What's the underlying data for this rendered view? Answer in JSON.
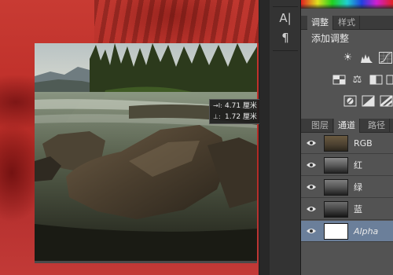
{
  "measurement": {
    "width_label": "4.71 厘米",
    "height_label": "1.72 厘米"
  },
  "tools": {
    "type_tool_glyph": "A|",
    "paragraph_glyph": "¶"
  },
  "adjustments_panel": {
    "tabs": [
      "调整",
      "样式"
    ],
    "active_tab": "调整",
    "title": "添加调整",
    "icons": [
      "brightness-contrast-icon",
      "levels-icon",
      "curves-icon",
      "exposure-icon",
      "vibrance-icon",
      "hue-saturation-icon",
      "color-balance-icon",
      "black-white-icon",
      "photo-filter-icon",
      "invert-icon",
      "posterize-icon",
      "gradient-map-icon"
    ]
  },
  "channels_panel": {
    "tabs": [
      "图层",
      "通道",
      "路径"
    ],
    "active_tab": "通道",
    "channels": [
      {
        "label": "RGB",
        "selected": false,
        "visible": true
      },
      {
        "label": "红",
        "selected": false,
        "visible": true
      },
      {
        "label": "绿",
        "selected": false,
        "visible": true
      },
      {
        "label": "蓝",
        "selected": false,
        "visible": true
      },
      {
        "label": "Alpha",
        "selected": true,
        "visible": true
      }
    ]
  },
  "colors": {
    "quick_mask": "#c8302b",
    "panel_bg": "#535353",
    "selected_row": "#6b7f9a"
  }
}
